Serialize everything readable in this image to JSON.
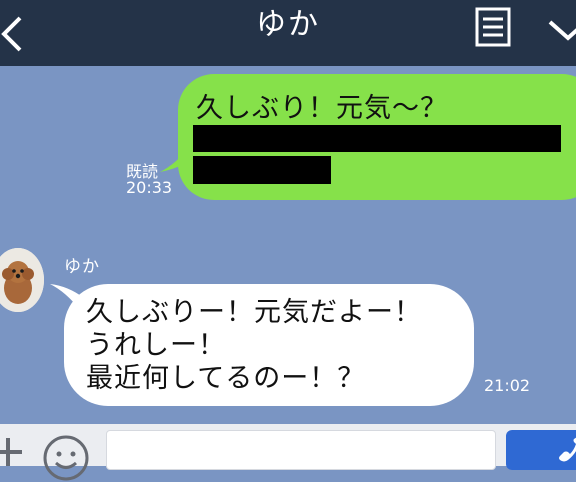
{
  "header": {
    "title": "ゆか"
  },
  "icons": {
    "back": "back-chevron-icon",
    "menu": "menu-icon",
    "dropdown": "chevron-down-icon",
    "plus": "plus-icon",
    "emoji": "emoji-icon",
    "call": "phone-icon"
  },
  "messages": [
    {
      "direction": "outgoing",
      "text": "久しぶり！元気〜？",
      "read_label": "既読",
      "time": "20:33",
      "redacted_lines": 2
    },
    {
      "direction": "incoming",
      "sender": "ゆか",
      "lines": [
        "久しぶりー！元気だよー！",
        "うれしー！",
        "最近何してるのー！？"
      ],
      "time": "21:02"
    }
  ],
  "input": {
    "value": "",
    "placeholder": ""
  },
  "colors": {
    "header_bg": "#243348",
    "chat_bg": "#7a95c3",
    "outgoing_bubble": "#86e14a",
    "incoming_bubble": "#ffffff",
    "send_button": "#2f69d3"
  }
}
